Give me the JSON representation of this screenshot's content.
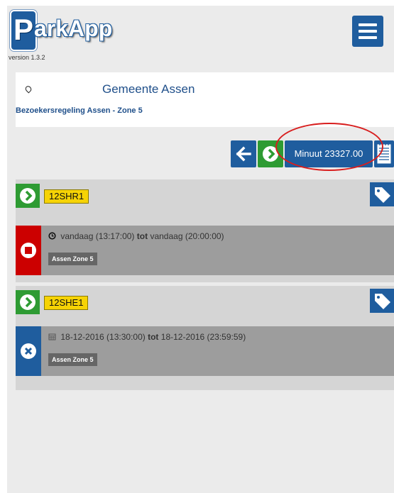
{
  "header": {
    "logo_letter": "P",
    "logo_text": "arkApp",
    "version": "version 1.3.2"
  },
  "location": {
    "municipality": "Gemeente Assen",
    "regulation": "Bezoekersregeling Assen - Zone 5"
  },
  "toolbar": {
    "balance_label": "Minuut 23327.00"
  },
  "vehicles": [
    {
      "plate": "12SHR1",
      "session": {
        "start_label": "vandaag (13:17:00)",
        "connector": "tot",
        "end_label": "vandaag (20:00:00)",
        "zone": "Assen Zone 5",
        "status": "active"
      }
    },
    {
      "plate": "12SHE1",
      "session": {
        "start_label": "18-12-2016 (13:30:00)",
        "connector": "tot",
        "end_label": "18-12-2016 (23:59:59)",
        "zone": "Assen Zone 5",
        "status": "scheduled"
      }
    }
  ],
  "colors": {
    "primary_blue": "#1f5d9e",
    "green": "#2e9b33",
    "red": "#cc0000",
    "plate_yellow": "#f6d305",
    "annotation_red": "#d81e1e"
  }
}
